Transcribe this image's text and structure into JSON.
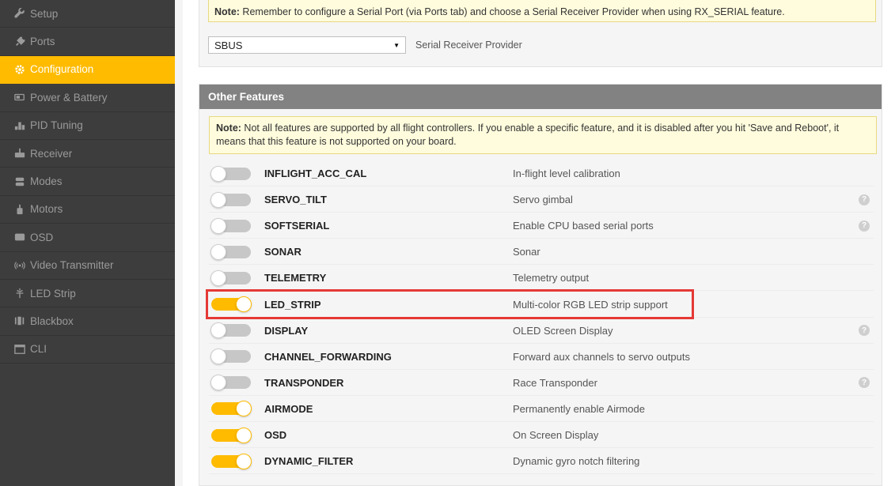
{
  "sidebar": {
    "items": [
      {
        "label": "Setup",
        "icon": "wrench-icon"
      },
      {
        "label": "Ports",
        "icon": "plug-icon"
      },
      {
        "label": "Configuration",
        "icon": "gear-icon",
        "active": true
      },
      {
        "label": "Power & Battery",
        "icon": "battery-icon"
      },
      {
        "label": "PID Tuning",
        "icon": "tuning-icon"
      },
      {
        "label": "Receiver",
        "icon": "receiver-icon"
      },
      {
        "label": "Modes",
        "icon": "modes-icon"
      },
      {
        "label": "Motors",
        "icon": "motor-icon"
      },
      {
        "label": "OSD",
        "icon": "osd-icon"
      },
      {
        "label": "Video Transmitter",
        "icon": "signal-icon"
      },
      {
        "label": "LED Strip",
        "icon": "led-icon"
      },
      {
        "label": "Blackbox",
        "icon": "blackbox-icon"
      },
      {
        "label": "CLI",
        "icon": "terminal-icon"
      }
    ]
  },
  "receiver": {
    "note_bold": "Note:",
    "note_text": " Remember to configure a Serial Port (via Ports tab) and choose a Serial Receiver Provider when using RX_SERIAL feature.",
    "provider_value": "SBUS",
    "provider_label": "Serial Receiver Provider"
  },
  "other_features": {
    "title": "Other Features",
    "note_bold": "Note:",
    "note_text": " Not all features are supported by all flight controllers. If you enable a specific feature, and it is disabled after you hit 'Save and Reboot', it means that this feature is not supported on your board.",
    "features": [
      {
        "name": "INFLIGHT_ACC_CAL",
        "description": "In-flight level calibration",
        "enabled": false,
        "help": false
      },
      {
        "name": "SERVO_TILT",
        "description": "Servo gimbal",
        "enabled": false,
        "help": true
      },
      {
        "name": "SOFTSERIAL",
        "description": "Enable CPU based serial ports",
        "enabled": false,
        "help": true
      },
      {
        "name": "SONAR",
        "description": "Sonar",
        "enabled": false,
        "help": false
      },
      {
        "name": "TELEMETRY",
        "description": "Telemetry output",
        "enabled": false,
        "help": false
      },
      {
        "name": "LED_STRIP",
        "description": "Multi-color RGB LED strip support",
        "enabled": true,
        "help": false
      },
      {
        "name": "DISPLAY",
        "description": "OLED Screen Display",
        "enabled": false,
        "help": true
      },
      {
        "name": "CHANNEL_FORWARDING",
        "description": "Forward aux channels to servo outputs",
        "enabled": false,
        "help": false
      },
      {
        "name": "TRANSPONDER",
        "description": "Race Transponder",
        "enabled": false,
        "help": true
      },
      {
        "name": "AIRMODE",
        "description": "Permanently enable Airmode",
        "enabled": true,
        "help": false
      },
      {
        "name": "OSD",
        "description": "On Screen Display",
        "enabled": true,
        "help": false
      },
      {
        "name": "DYNAMIC_FILTER",
        "description": "Dynamic gyro notch filtering",
        "enabled": true,
        "help": false
      }
    ]
  },
  "help_glyph": "?",
  "select_arrow": "▼",
  "colors": {
    "accent": "#ffbb00",
    "sidebar_bg": "#3d3d3d",
    "highlight": "#e53935"
  }
}
